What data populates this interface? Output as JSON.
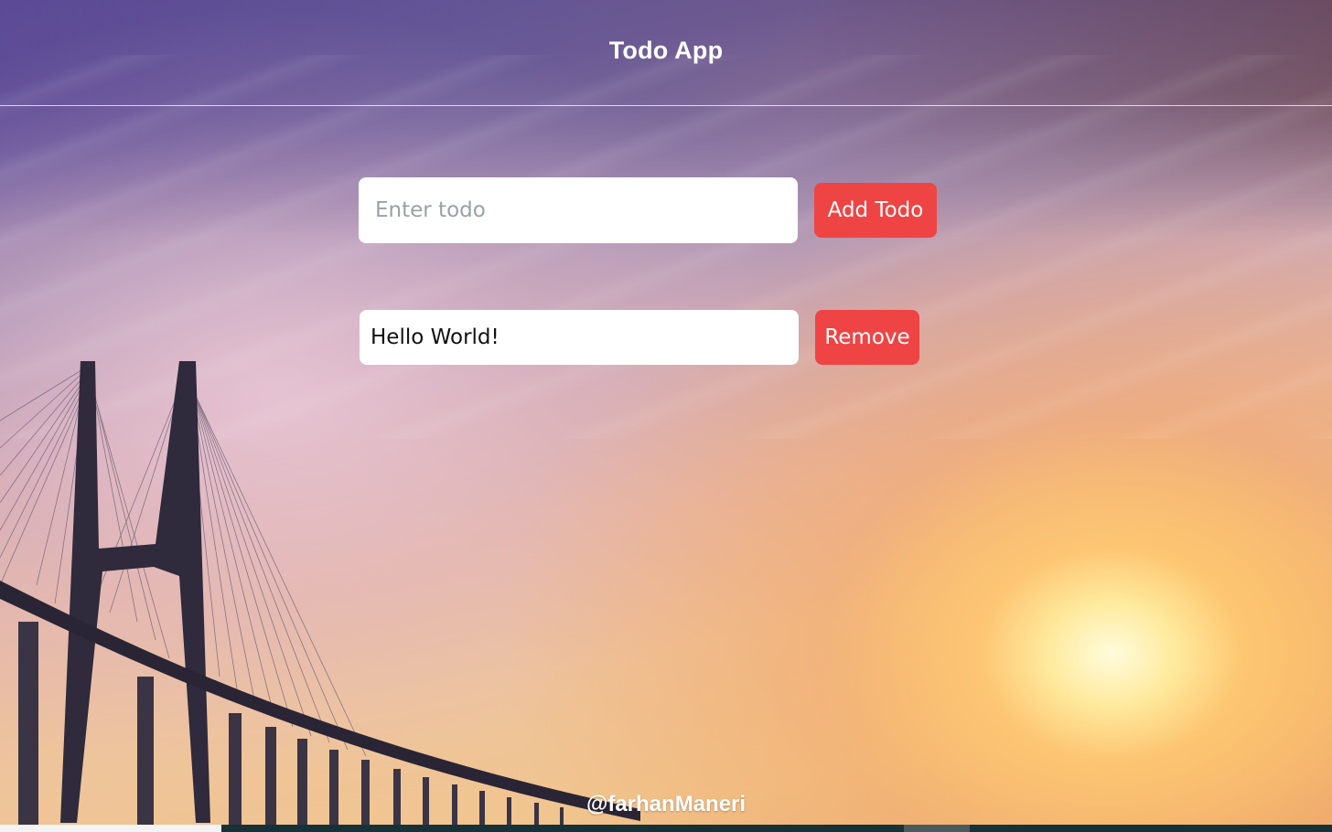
{
  "header": {
    "title": "Todo App"
  },
  "form": {
    "placeholder": "Enter todo",
    "value": "",
    "add_button_label": "Add Todo"
  },
  "todos": [
    {
      "text": "Hello World!",
      "remove_label": "Remove"
    }
  ],
  "footer": {
    "credit": "@farhanManeri"
  },
  "colors": {
    "accent": "#ef4444",
    "text_on_accent": "#ffffff"
  }
}
